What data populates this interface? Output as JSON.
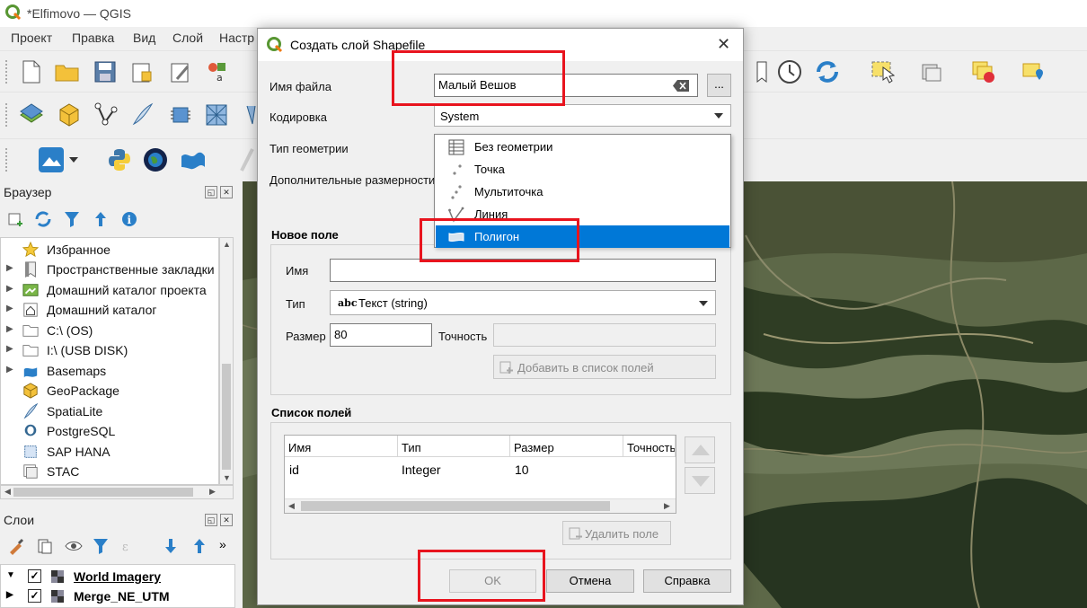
{
  "window": {
    "title": "*Elfimovo — QGIS"
  },
  "menu": [
    "Проект",
    "Правка",
    "Вид",
    "Слой",
    "Настр"
  ],
  "browser": {
    "title": "Браузер",
    "items": [
      {
        "label": "Избранное",
        "icon": "star-icon",
        "expandable": false
      },
      {
        "label": "Пространственные закладки",
        "icon": "bookmark-icon",
        "expandable": true
      },
      {
        "label": "Домашний каталог проекта",
        "icon": "project-home-icon",
        "expandable": true
      },
      {
        "label": "Домашний каталог",
        "icon": "home-icon",
        "expandable": true
      },
      {
        "label": "C:\\ (OS)",
        "icon": "folder-icon",
        "expandable": true
      },
      {
        "label": "I:\\ (USB DISK)",
        "icon": "folder-icon",
        "expandable": true
      },
      {
        "label": "Basemaps",
        "icon": "basemaps-icon",
        "expandable": true
      },
      {
        "label": "GeoPackage",
        "icon": "geopackage-icon",
        "expandable": false
      },
      {
        "label": "SpatiaLite",
        "icon": "spatialite-icon",
        "expandable": false
      },
      {
        "label": "PostgreSQL",
        "icon": "postgresql-icon",
        "expandable": false
      },
      {
        "label": "SAP HANA",
        "icon": "sap-hana-icon",
        "expandable": false
      },
      {
        "label": "STAC",
        "icon": "stac-icon",
        "expandable": false
      }
    ]
  },
  "layers": {
    "title": "Слои",
    "items": [
      {
        "label": "World Imagery",
        "checked": true,
        "underline": true
      },
      {
        "label": "Merge_NE_UTM",
        "checked": true,
        "underline": false
      }
    ]
  },
  "dialog": {
    "title": "Создать слой Shapefile",
    "file_name_label": "Имя файла",
    "file_name_value": "Малый Вешов",
    "browse_label": "...",
    "encoding_label": "Кодировка",
    "encoding_value": "System",
    "geometry_type_label": "Тип геометрии",
    "extra_dims_label": "Дополнительные размерности",
    "geometry_options": [
      {
        "label": "Без геометрии",
        "icon": "table-icon",
        "selected": false
      },
      {
        "label": "Точка",
        "icon": "point-icon",
        "selected": false
      },
      {
        "label": "Мультиточка",
        "icon": "multipoint-icon",
        "selected": false
      },
      {
        "label": "Линия",
        "icon": "line-icon",
        "selected": false
      },
      {
        "label": "Полигон",
        "icon": "polygon-icon",
        "selected": true
      }
    ],
    "new_field": {
      "title": "Новое поле",
      "name_label": "Имя",
      "name_value": "",
      "type_label": "Тип",
      "type_prefix": "abc",
      "type_value": "Текст (string)",
      "length_label": "Размер",
      "length_value": "80",
      "precision_label": "Точность",
      "precision_value": "",
      "add_button": "Добавить в список полей"
    },
    "field_list": {
      "title": "Список полей",
      "columns": [
        "Имя",
        "Тип",
        "Размер",
        "Точность"
      ],
      "rows": [
        [
          "id",
          "Integer",
          "10",
          ""
        ]
      ],
      "remove_button": "Удалить поле"
    },
    "ok_label": "OK",
    "cancel_label": "Отмена",
    "help_label": "Справка"
  },
  "colors": {
    "highlight": "#e8141e",
    "selection": "#0078d7",
    "qgis_green": "#589632"
  }
}
